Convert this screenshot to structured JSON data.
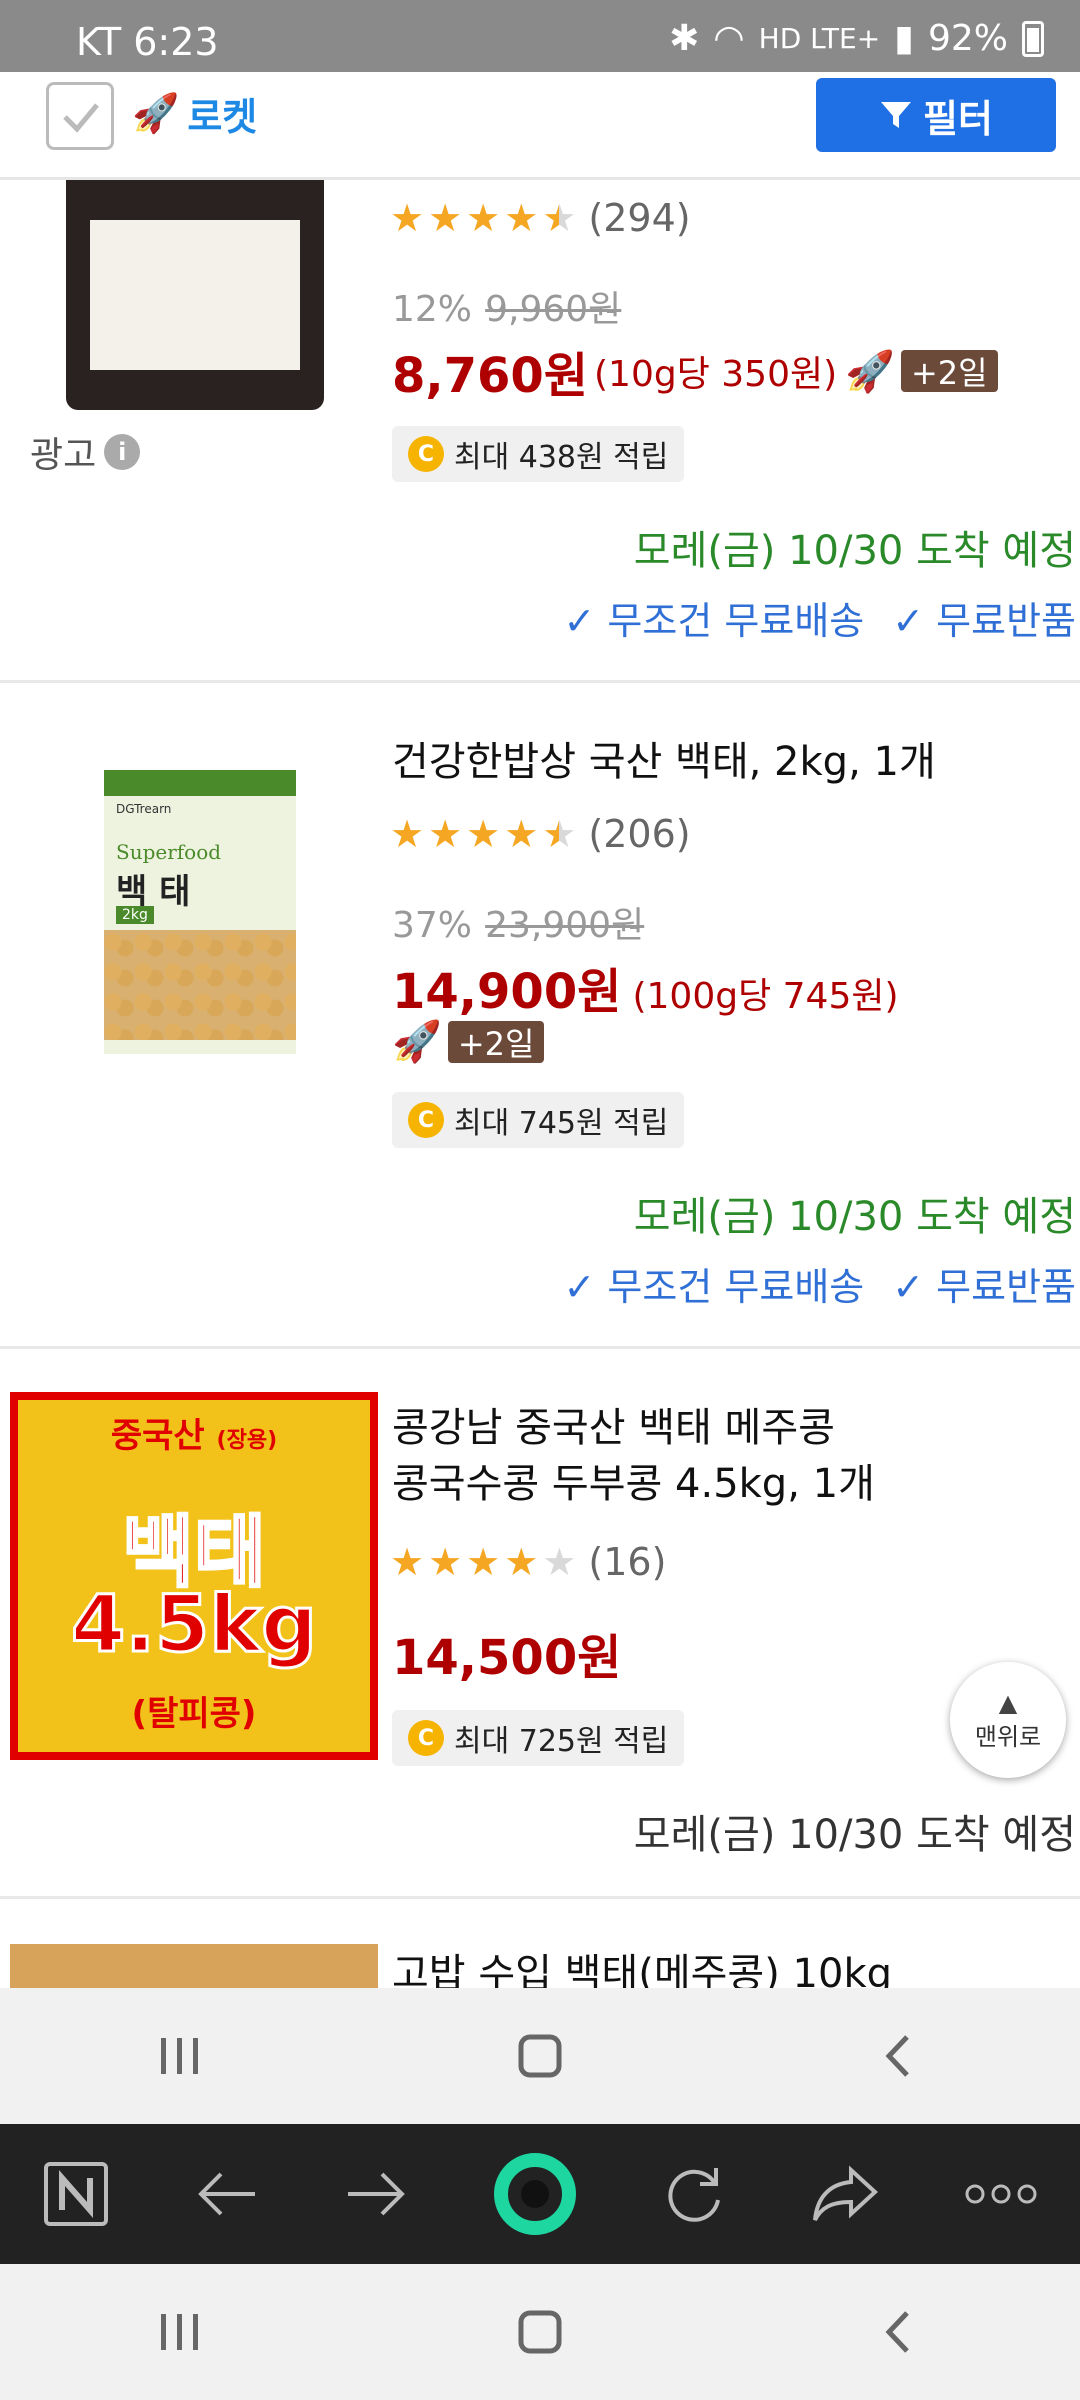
{
  "status_bar": {
    "carrier_time": "KT 6:23",
    "signal_text": "HD LTE+",
    "battery": "92%"
  },
  "top_bar": {
    "rocket_label": "로켓",
    "filter_label": "필터"
  },
  "products": [
    {
      "rating_count": "(294)",
      "stars": 4.5,
      "discount": "12%",
      "original_price": "9,960원",
      "price": "8,760원",
      "unit_price": "(10g당 350원)",
      "delivery_badge": "+2일",
      "reward": "최대 438원 적립",
      "ad_label": "광고",
      "arrival": "모레(금) 10/30 도착 예정",
      "free_shipping": "✓ 무조건 무료배송",
      "free_return": "✓ 무료반품"
    },
    {
      "title": "건강한밥상 국산 백태, 2kg, 1개",
      "stars": 4.5,
      "rating_count": "(206)",
      "discount": "37%",
      "original_price": "23,900원",
      "price": "14,900원",
      "unit_price": "(100g당 745원)",
      "delivery_badge": "+2일",
      "reward": "최대 745원 적립",
      "arrival": "모레(금) 10/30 도착 예정",
      "free_shipping": "✓ 무조건 무료배송",
      "free_return": "✓ 무료반품",
      "image_text": {
        "brand": "DGTrearn",
        "label": "Superfood",
        "name": "백 태",
        "size": "2kg"
      }
    },
    {
      "title_line1": "콩강남 중국산 백태 메주콩",
      "title_line2": "콩국수콩 두부콩 4.5kg, 1개",
      "stars": 4,
      "rating_count": "(16)",
      "price": "14,500원",
      "reward": "최대 725원 적립",
      "arrival": "모레(금) 10/30 도착 예정",
      "image_text": {
        "origin": "중국산",
        "usage": "(장용)",
        "name": "백태",
        "weight": "4.5kg",
        "type": "(탈피콩)"
      }
    },
    {
      "title_partial": "고밥 수입 백태(메주콩) 10kg"
    }
  ],
  "scroll_top": {
    "label": "맨위로"
  },
  "colors": {
    "accent_blue": "#1f6fe5",
    "price_red": "#ae0000",
    "arrival_green": "#2a8a2a",
    "star": "#f5a623"
  }
}
